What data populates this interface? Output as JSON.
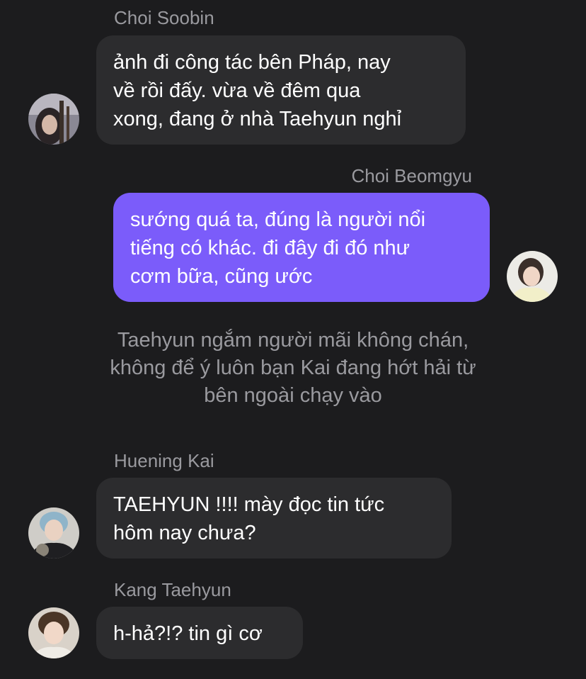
{
  "messages": [
    {
      "sender": "Choi Soobin",
      "direction": "incoming",
      "text": "ảnh đi công tác bên Pháp, nay\nvề rồi đấy. vừa về đêm qua\nxong, đang ở nhà Taehyun nghỉ",
      "avatar_icon": "avatar-soobin"
    },
    {
      "sender": "Choi Beomgyu",
      "direction": "outgoing",
      "text": "sướng quá ta, đúng là người nổi\ntiếng có khác. đi đây đi đó như\ncơm bữa, cũng ước",
      "avatar_icon": "avatar-beomgyu"
    },
    {
      "sender": "Huening Kai",
      "direction": "incoming",
      "text": "TAEHYUN !!!! mày đọc tin tức\nhôm nay chưa?",
      "avatar_icon": "avatar-huening-kai"
    },
    {
      "sender": "Kang Taehyun",
      "direction": "incoming",
      "text": "h-hả?!? tin gì cơ",
      "avatar_icon": "avatar-taehyun"
    }
  ],
  "narration": {
    "text": "Taehyun ngắm người mãi không chán,\nkhông để ý luôn bạn Kai đang hớt hải từ\nbên ngoài chạy vào"
  },
  "colors": {
    "background": "#1c1c1e",
    "incoming_bubble": "#2c2c2e",
    "outgoing_bubble": "#7b5cfa",
    "secondary_text": "#9a9a9f"
  }
}
